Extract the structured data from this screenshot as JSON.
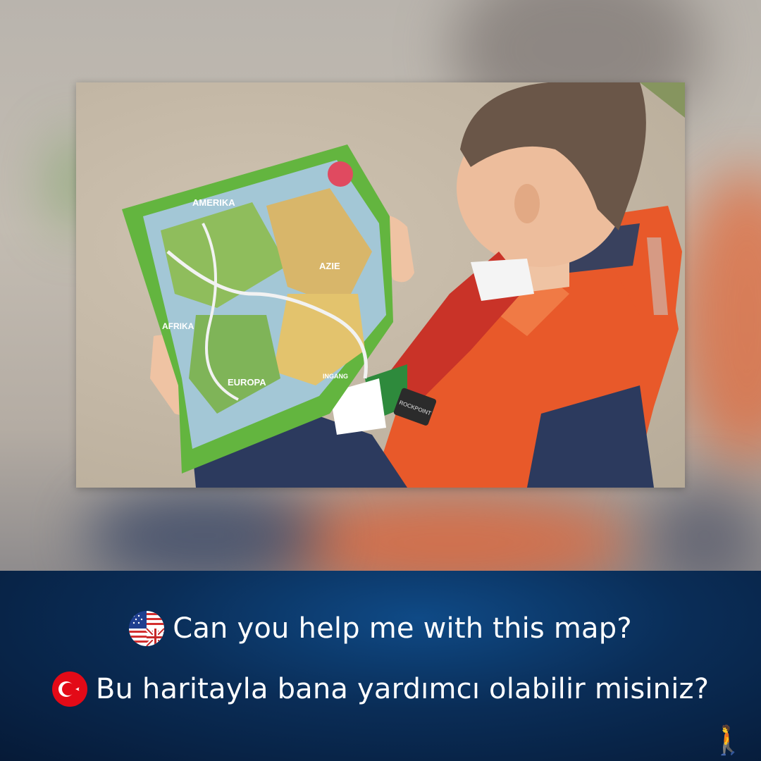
{
  "caption": {
    "english": {
      "flag_icon": "us-uk-flag-icon",
      "text": "Can you help me with this map?"
    },
    "turkish": {
      "flag_icon": "turkey-flag-icon",
      "text": "Bu haritayla bana yardımcı olabilir misiniz?"
    }
  },
  "photo": {
    "map_labels": [
      "AMERIKA",
      "AZIE",
      "AFRIKA",
      "EUROPA",
      "INGANG"
    ],
    "jacket_badge": "ROCKPOINT"
  },
  "decor": {
    "walker_icon": "person-walking-icon"
  },
  "colors": {
    "band_dark": "#061a37",
    "band_light": "#0f4a86",
    "text": "#ffffff",
    "jacket_orange": "#e8592a",
    "map_green": "#63b53f"
  }
}
